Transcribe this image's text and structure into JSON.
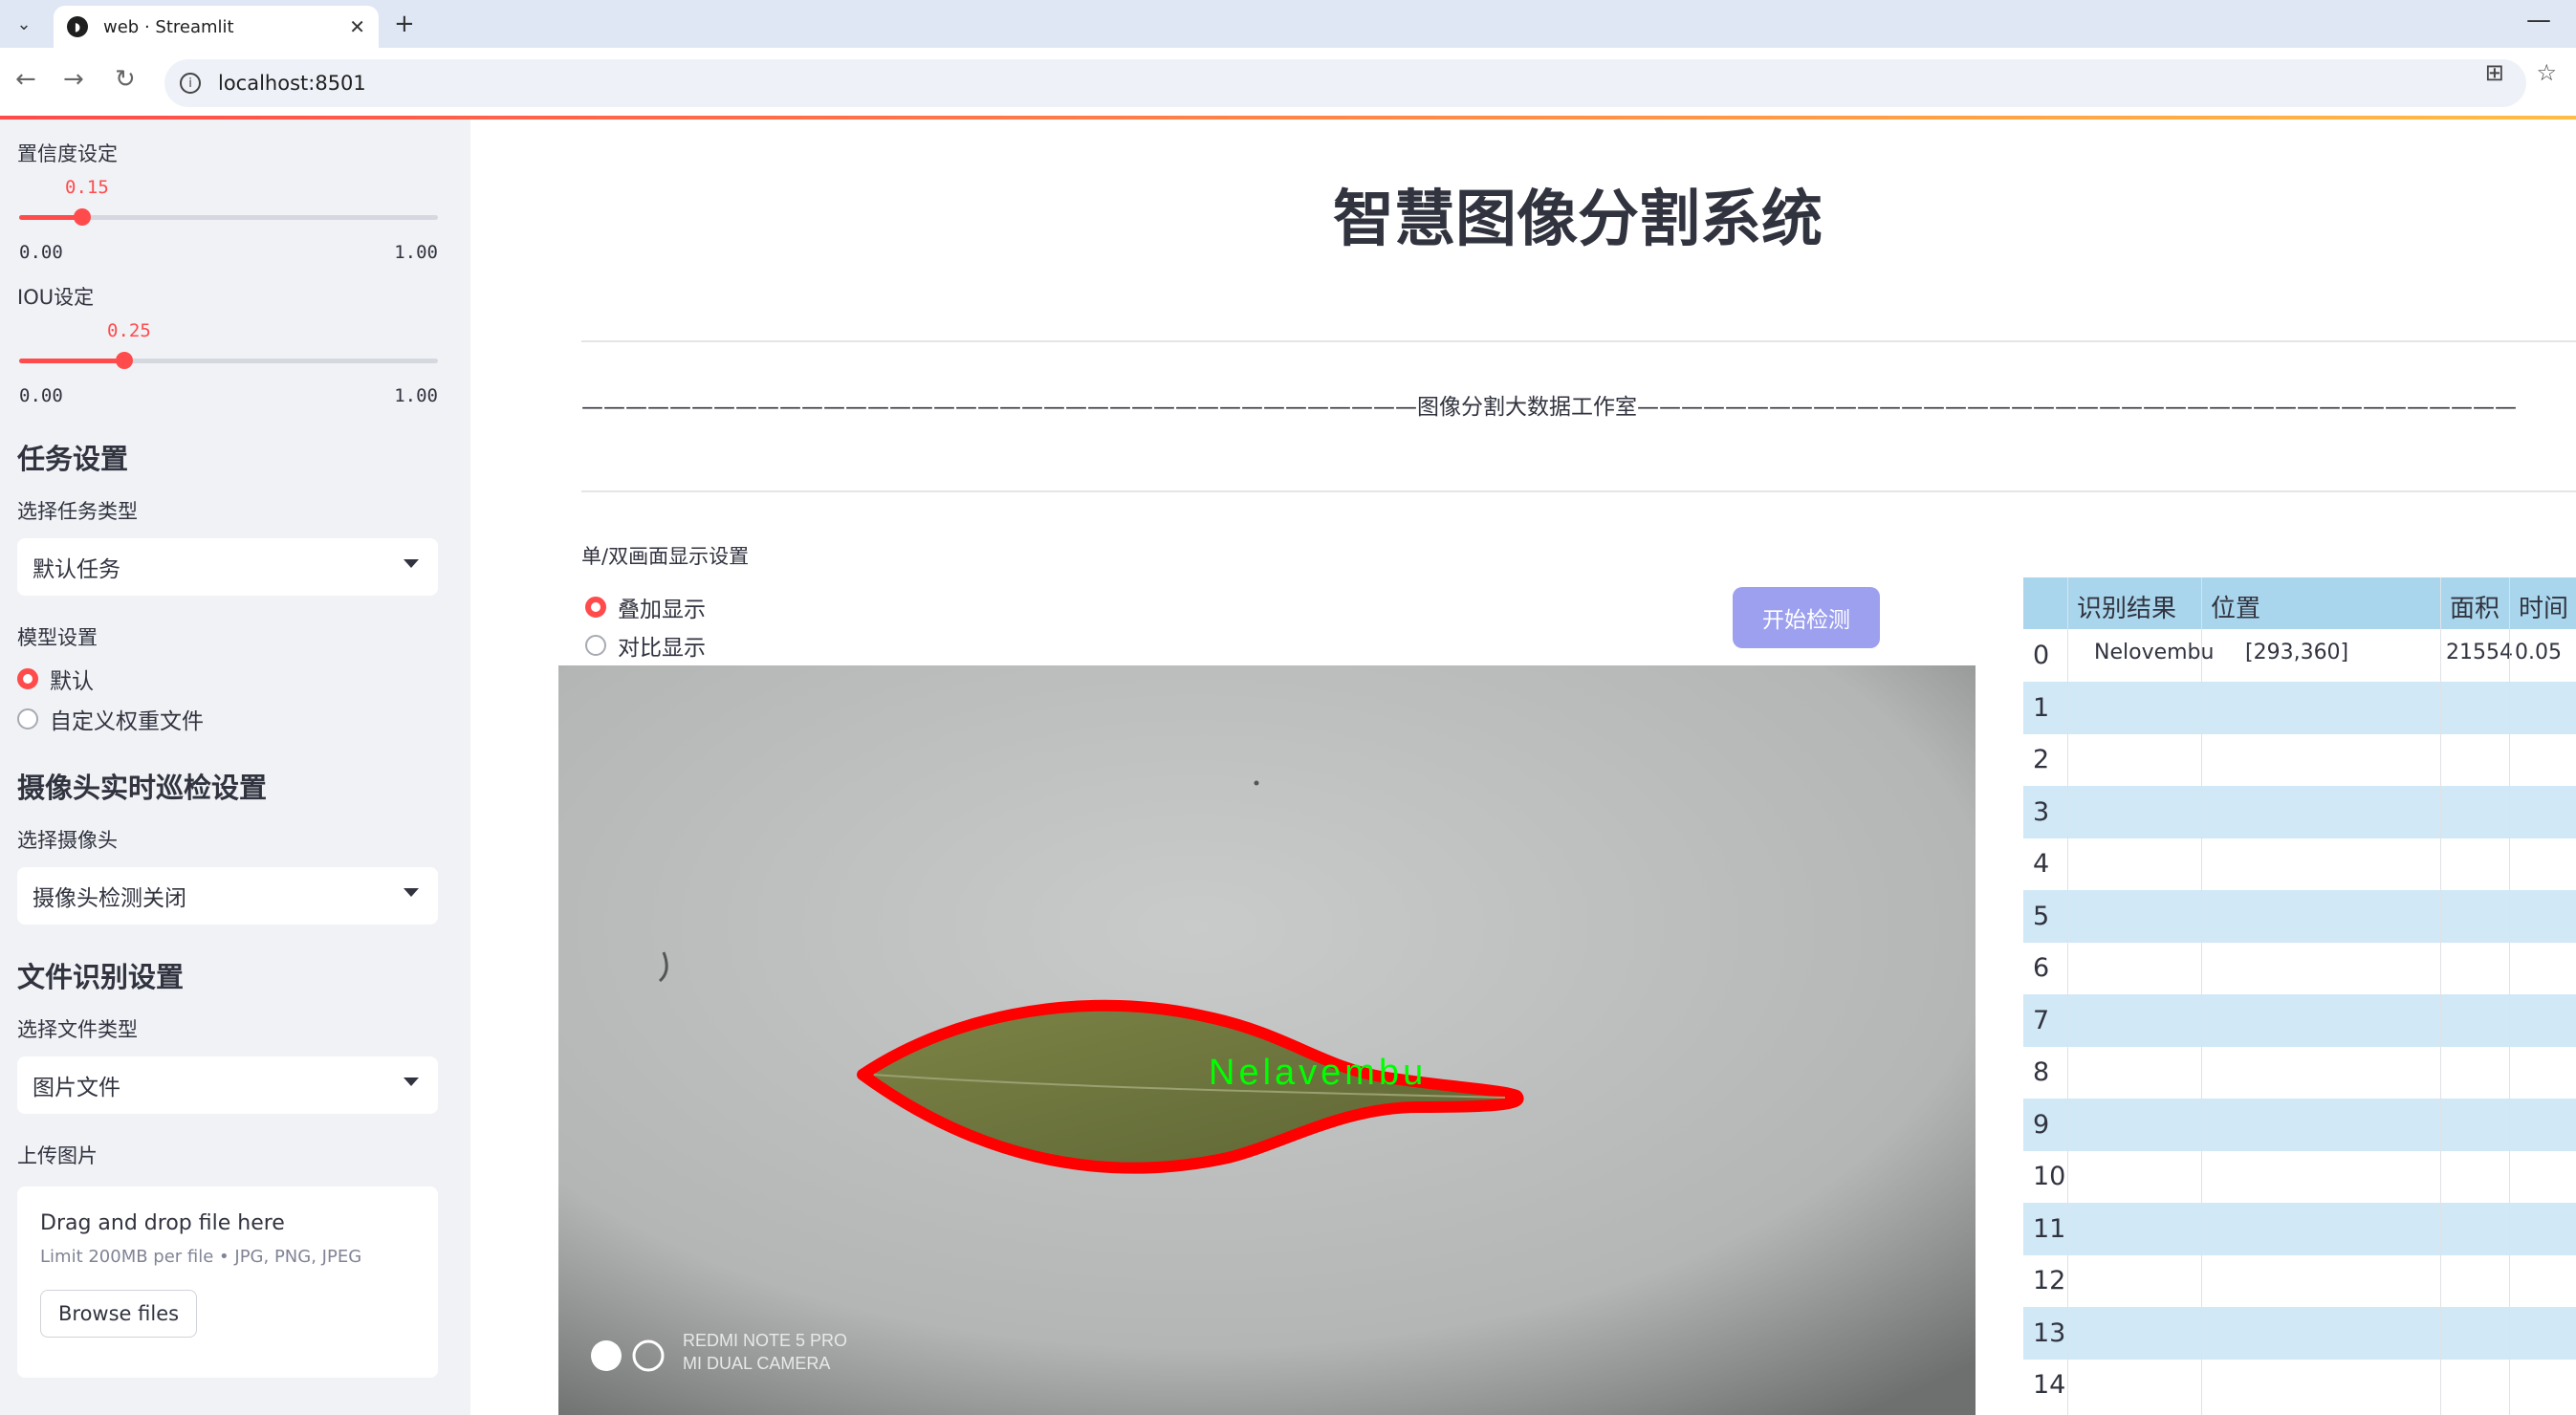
{
  "browser": {
    "tab_title": "web · Streamlit",
    "url": "localhost:8501"
  },
  "sidebar": {
    "confidence": {
      "label": "置信度设定",
      "value": "0.15",
      "min": "0.00",
      "max": "1.00",
      "fraction": 0.15
    },
    "iou": {
      "label": "IOU设定",
      "value": "0.25",
      "min": "0.00",
      "max": "1.00",
      "fraction": 0.25
    },
    "task": {
      "heading": "任务设置",
      "select_label": "选择任务类型",
      "selected": "默认任务"
    },
    "model": {
      "label": "模型设置",
      "options": [
        "默认",
        "自定义权重文件"
      ],
      "selected_index": 0
    },
    "camera": {
      "heading": "摄像头实时巡检设置",
      "select_label": "选择摄像头",
      "selected": "摄像头检测关闭"
    },
    "file": {
      "heading": "文件识别设置",
      "select_label": "选择文件类型",
      "selected": "图片文件"
    },
    "upload": {
      "label": "上传图片",
      "drop_text": "Drag and drop file here",
      "limit_text": "Limit 200MB per file • JPG, PNG, JPEG",
      "browse_label": "Browse files"
    }
  },
  "main": {
    "title": "智慧图像分割系统",
    "banner": "——————————————————————————————————————图像分割大数据工作室————————————————————————————————————————",
    "display_setting_label": "单/双画面显示设置",
    "display_options": [
      "叠加显示",
      "对比显示"
    ],
    "display_selected_index": 0,
    "start_button": "开始检测",
    "detection": {
      "label": "Nelavembu",
      "camera_watermark_line1": "REDMI NOTE 5 PRO",
      "camera_watermark_line2": "MI DUAL CAMERA"
    }
  },
  "results_table": {
    "columns": [
      "识别结果",
      "位置",
      "面积",
      "时间"
    ],
    "row_indices": [
      "0",
      "1",
      "2",
      "3",
      "4",
      "5",
      "6",
      "7",
      "8",
      "9",
      "10",
      "11",
      "12",
      "13",
      "14"
    ],
    "rows": [
      {
        "result": "Nelovembu",
        "position": "[293,360]",
        "area": "21554",
        "time": "0.05"
      }
    ]
  },
  "colors": {
    "accent": "#ff4b4b",
    "start_button": "#9da0ee",
    "table_header": "#a9d6ec",
    "table_alt_row": "#d1e8f6",
    "detection_outline": "#ff0000",
    "detection_label": "#00ff00"
  }
}
